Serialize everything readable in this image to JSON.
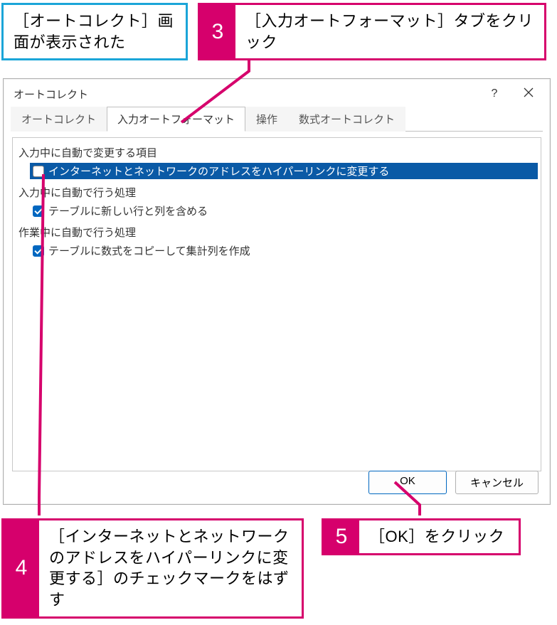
{
  "callouts": {
    "info": "［オートコレクト］画面が表示された",
    "step3_num": "3",
    "step3_text": "［入力オートフォーマット］タブをクリック",
    "step4_num": "4",
    "step4_text": "［インターネットとネットワークのアドレスをハイパーリンクに変更する］のチェックマークをはずす",
    "step5_num": "5",
    "step5_text": "［OK］をクリック"
  },
  "dialog": {
    "title": "オートコレクト",
    "help_label": "?",
    "close_label": "×",
    "tabs": {
      "autocorrect": "オートコレクト",
      "autoformat": "入力オートフォーマット",
      "actions": "操作",
      "math": "数式オートコレクト"
    },
    "groups": {
      "replace_label": "入力中に自動で変更する項目",
      "opt_hyperlink": "インターネットとネットワークのアドレスをハイパーリンクに変更する",
      "apply_label": "入力中に自動で行う処理",
      "opt_tablerows": "テーブルに新しい行と列を含める",
      "working_label": "作業中に自動で行う処理",
      "opt_formulas": "テーブルに数式をコピーして集計列を作成"
    },
    "buttons": {
      "ok": "OK",
      "cancel": "キャンセル"
    }
  }
}
